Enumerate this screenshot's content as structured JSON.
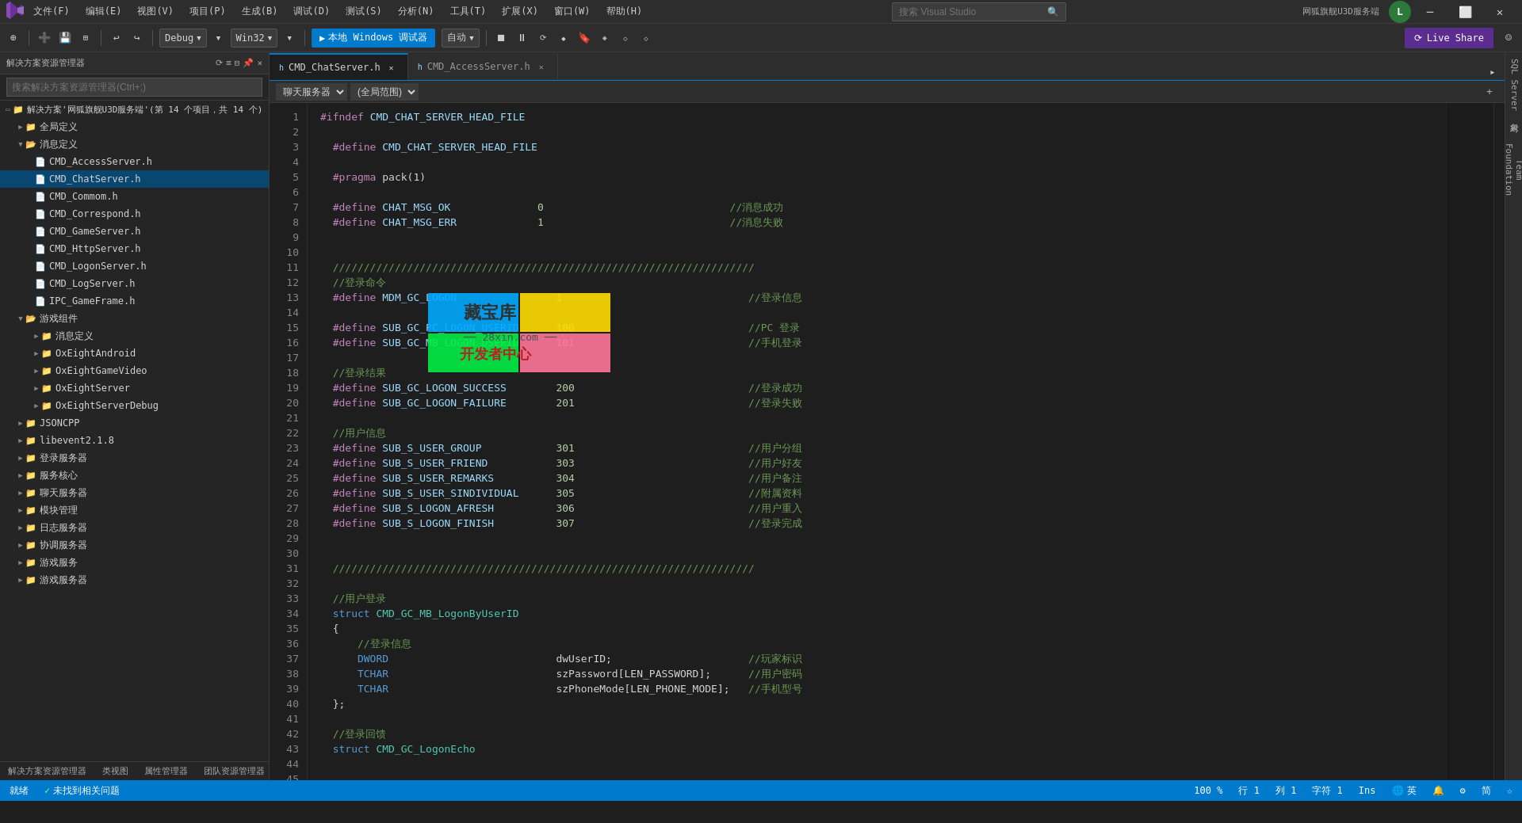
{
  "app": {
    "title": "网狐旗舰U3D服务端",
    "search_placeholder": "搜索 Visual Studio"
  },
  "menu": {
    "items": [
      "文件(F)",
      "编辑(E)",
      "视图(V)",
      "项目(P)",
      "生成(B)",
      "调试(D)",
      "测试(S)",
      "分析(N)",
      "工具(T)",
      "扩展(X)",
      "窗口(W)",
      "帮助(H)"
    ]
  },
  "toolbar": {
    "debug_config": "Debug",
    "platform": "Win32",
    "run_label": "本地 Windows 调试器",
    "run_config": "自动",
    "live_share": "Live Share"
  },
  "sidebar": {
    "title": "解决方案资源管理器",
    "search_placeholder": "搜索解决方案资源管理器(Ctrl+;)",
    "solution_label": "解决方案'网狐旗舰U3D服务端'(第 14 个项目，共 14 个)",
    "items": [
      {
        "id": "global-def",
        "label": "全局定义",
        "level": 1,
        "type": "folder",
        "expanded": false
      },
      {
        "id": "msg-def",
        "label": "消息定义",
        "level": 1,
        "type": "folder",
        "expanded": true
      },
      {
        "id": "cmd-access",
        "label": "CMD_AccessServer.h",
        "level": 2,
        "type": "file-h"
      },
      {
        "id": "cmd-chat",
        "label": "CMD_ChatServer.h",
        "level": 2,
        "type": "file-h",
        "active": true
      },
      {
        "id": "cmd-common",
        "label": "CMD_Commom.h",
        "level": 2,
        "type": "file-h"
      },
      {
        "id": "cmd-correspond",
        "label": "CMD_Correspond.h",
        "level": 2,
        "type": "file-h"
      },
      {
        "id": "cmd-game",
        "label": "CMD_GameServer.h",
        "level": 2,
        "type": "file-h"
      },
      {
        "id": "cmd-http",
        "label": "CMD_HttpServer.h",
        "level": 2,
        "type": "file-h"
      },
      {
        "id": "cmd-logon",
        "label": "CMD_LogonServer.h",
        "level": 2,
        "type": "file-h"
      },
      {
        "id": "cmd-log",
        "label": "CMD_LogServer.h",
        "level": 2,
        "type": "file-h"
      },
      {
        "id": "ipc-game",
        "label": "IPC_GameFrame.h",
        "level": 2,
        "type": "file-h"
      },
      {
        "id": "game-comp",
        "label": "游戏组件",
        "level": 1,
        "type": "folder",
        "expanded": true
      },
      {
        "id": "msg-def2",
        "label": "消息定义",
        "level": 2,
        "type": "folder",
        "expanded": false
      },
      {
        "id": "oxeight-android",
        "label": "OxEightAndroid",
        "level": 2,
        "type": "folder",
        "expanded": false
      },
      {
        "id": "oxeight-video",
        "label": "OxEightGameVideo",
        "level": 2,
        "type": "folder",
        "expanded": false
      },
      {
        "id": "oxeight-server",
        "label": "OxEightServer",
        "level": 2,
        "type": "folder",
        "expanded": false
      },
      {
        "id": "oxeight-debug",
        "label": "OxEightServerDebug",
        "level": 2,
        "type": "folder",
        "expanded": false
      },
      {
        "id": "jsoncpp",
        "label": "JSONCPP",
        "level": 1,
        "type": "folder",
        "expanded": false
      },
      {
        "id": "libevent",
        "label": "libevent2.1.8",
        "level": 1,
        "type": "folder",
        "expanded": false
      },
      {
        "id": "logon-server",
        "label": "登录服务器",
        "level": 1,
        "type": "folder",
        "expanded": false
      },
      {
        "id": "service-core",
        "label": "服务核心",
        "level": 1,
        "type": "folder",
        "expanded": false
      },
      {
        "id": "chat-server",
        "label": "聊天服务器",
        "level": 1,
        "type": "folder",
        "expanded": false
      },
      {
        "id": "module-mgr",
        "label": "模块管理",
        "level": 1,
        "type": "folder",
        "expanded": false
      },
      {
        "id": "log-server",
        "label": "日志服务器",
        "level": 1,
        "type": "folder",
        "expanded": false
      },
      {
        "id": "coord-server",
        "label": "协调服务器",
        "level": 1,
        "type": "folder",
        "expanded": false
      },
      {
        "id": "game-service",
        "label": "游戏服务",
        "level": 1,
        "type": "folder",
        "expanded": false
      },
      {
        "id": "game-server",
        "label": "游戏服务器",
        "level": 1,
        "type": "folder",
        "expanded": false
      }
    ],
    "bottom_tabs": [
      "解决方案资源管理器",
      "类视图",
      "属性管理器",
      "团队资源管理器"
    ]
  },
  "tabs": [
    {
      "label": "CMD_ChatServer.h",
      "active": true,
      "modified": false
    },
    {
      "label": "CMD_AccessServer.h",
      "active": false,
      "modified": false
    }
  ],
  "breadcrumb": {
    "file": "聊天服务器",
    "scope": "(全局范围)"
  },
  "editor": {
    "filename": "CMD_ChatServer.h",
    "lines": [
      {
        "n": 1,
        "code": "<span class='pp'>#ifndef</span> <span class='macro'>CMD_CHAT_SERVER_HEAD_FILE</span>"
      },
      {
        "n": 2,
        "code": ""
      },
      {
        "n": 3,
        "code": "  <span class='pp'>#define</span> <span class='macro'>CMD_CHAT_SERVER_HEAD_FILE</span>"
      },
      {
        "n": 4,
        "code": ""
      },
      {
        "n": 5,
        "code": "  <span class='pp'>#pragma</span> pack(1)"
      },
      {
        "n": 6,
        "code": ""
      },
      {
        "n": 7,
        "code": "  <span class='pp'>#define</span> <span class='macro'>CHAT_MSG_OK</span>              <span class='num'>0</span>                              <span class='comment'>//消息成功</span>"
      },
      {
        "n": 8,
        "code": "  <span class='pp'>#define</span> <span class='macro'>CHAT_MSG_ERR</span>             <span class='num'>1</span>                              <span class='comment'>//消息失败</span>"
      },
      {
        "n": 9,
        "code": ""
      },
      {
        "n": 10,
        "code": ""
      },
      {
        "n": 11,
        "code": "  <span class='comment'>////////////////////////////////////////////////////////////////////</span>"
      },
      {
        "n": 12,
        "code": "  <span class='comment'>//登录命令</span>"
      },
      {
        "n": 13,
        "code": "  <span class='pp'>#define</span> <span class='macro'>MDM_GC_LOGON</span>                <span class='num'>1</span>                              <span class='comment'>//登录信息</span>"
      },
      {
        "n": 14,
        "code": ""
      },
      {
        "n": 15,
        "code": "  <span class='pp'>#define</span> <span class='macro'>SUB_GC_PC_LOGON_USERID</span>      <span class='num'>100</span>                            <span class='comment'>//PC 登录</span>"
      },
      {
        "n": 16,
        "code": "  <span class='pp'>#define</span> <span class='macro'>SUB_GC_MB_LOGON_USERID</span>      <span class='num'>101</span>                            <span class='comment'>//手机登录</span>"
      },
      {
        "n": 17,
        "code": ""
      },
      {
        "n": 18,
        "code": "  <span class='comment'>//登录结果</span>"
      },
      {
        "n": 19,
        "code": "  <span class='pp'>#define</span> <span class='macro'>SUB_GC_LOGON_SUCCESS</span>        <span class='num'>200</span>                            <span class='comment'>//登录成功</span>"
      },
      {
        "n": 20,
        "code": "  <span class='pp'>#define</span> <span class='macro'>SUB_GC_LOGON_FAILURE</span>        <span class='num'>201</span>                            <span class='comment'>//登录失败</span>"
      },
      {
        "n": 21,
        "code": ""
      },
      {
        "n": 22,
        "code": "  <span class='comment'>//用户信息</span>"
      },
      {
        "n": 23,
        "code": "  <span class='pp'>#define</span> <span class='macro'>SUB_S_USER_GROUP</span>            <span class='num'>301</span>                            <span class='comment'>//用户分组</span>"
      },
      {
        "n": 24,
        "code": "  <span class='pp'>#define</span> <span class='macro'>SUB_S_USER_FRIEND</span>           <span class='num'>303</span>                            <span class='comment'>//用户好友</span>"
      },
      {
        "n": 25,
        "code": "  <span class='pp'>#define</span> <span class='macro'>SUB_S_USER_REMARKS</span>          <span class='num'>304</span>                            <span class='comment'>//用户备注</span>"
      },
      {
        "n": 26,
        "code": "  <span class='pp'>#define</span> <span class='macro'>SUB_S_USER_SINDIVIDUAL</span>      <span class='num'>305</span>                            <span class='comment'>//附属资料</span>"
      },
      {
        "n": 27,
        "code": "  <span class='pp'>#define</span> <span class='macro'>SUB_S_LOGON_AFRESH</span>          <span class='num'>306</span>                            <span class='comment'>//用户重入</span>"
      },
      {
        "n": 28,
        "code": "  <span class='pp'>#define</span> <span class='macro'>SUB_S_LOGON_FINISH</span>          <span class='num'>307</span>                            <span class='comment'>//登录完成</span>"
      },
      {
        "n": 29,
        "code": ""
      },
      {
        "n": 30,
        "code": ""
      },
      {
        "n": 31,
        "code": "  <span class='comment'>////////////////////////////////////////////////////////////////////</span>"
      },
      {
        "n": 32,
        "code": ""
      },
      {
        "n": 33,
        "code": "  <span class='comment'>//用户登录</span>"
      },
      {
        "n": 34,
        "code": "  <span class='kw'>struct</span> <span class='def'>CMD_GC_MB_LogonByUserID</span>"
      },
      {
        "n": 35,
        "code": "  {"
      },
      {
        "n": 36,
        "code": "      <span class='comment'>//登录信息</span>"
      },
      {
        "n": 37,
        "code": "      <span class='kw'>DWORD</span>                           dwUserID;                      <span class='comment'>//玩家标识</span>"
      },
      {
        "n": 38,
        "code": "      <span class='kw'>TCHAR</span>                           szPassword[LEN_PASSWORD];      <span class='comment'>//用户密码</span>"
      },
      {
        "n": 39,
        "code": "      <span class='kw'>TCHAR</span>                           szPhoneMode[LEN_PHONE_MODE];   <span class='comment'>//手机型号</span>"
      },
      {
        "n": 40,
        "code": "  };"
      },
      {
        "n": 41,
        "code": ""
      },
      {
        "n": 42,
        "code": "  <span class='comment'>//登录回馈</span>"
      },
      {
        "n": 43,
        "code": "  <span class='kw'>struct</span> <span class='def'>CMD_GC_LogonEcho</span>"
      }
    ]
  },
  "status_bar": {
    "status": "就绪",
    "line": "行 1",
    "col": "列 1",
    "char": "字符 1",
    "ins": "Ins",
    "check_status": "未找到相关问题",
    "lang": "英",
    "zoom": "100 %"
  },
  "right_sidebar_items": [
    "SQL Server 对象",
    "Team Foundation"
  ],
  "colors": {
    "accent": "#007acc",
    "sidebar_bg": "#252526",
    "editor_bg": "#1e1e1e",
    "toolbar_bg": "#2d2d2d",
    "status_bg": "#007acc"
  }
}
